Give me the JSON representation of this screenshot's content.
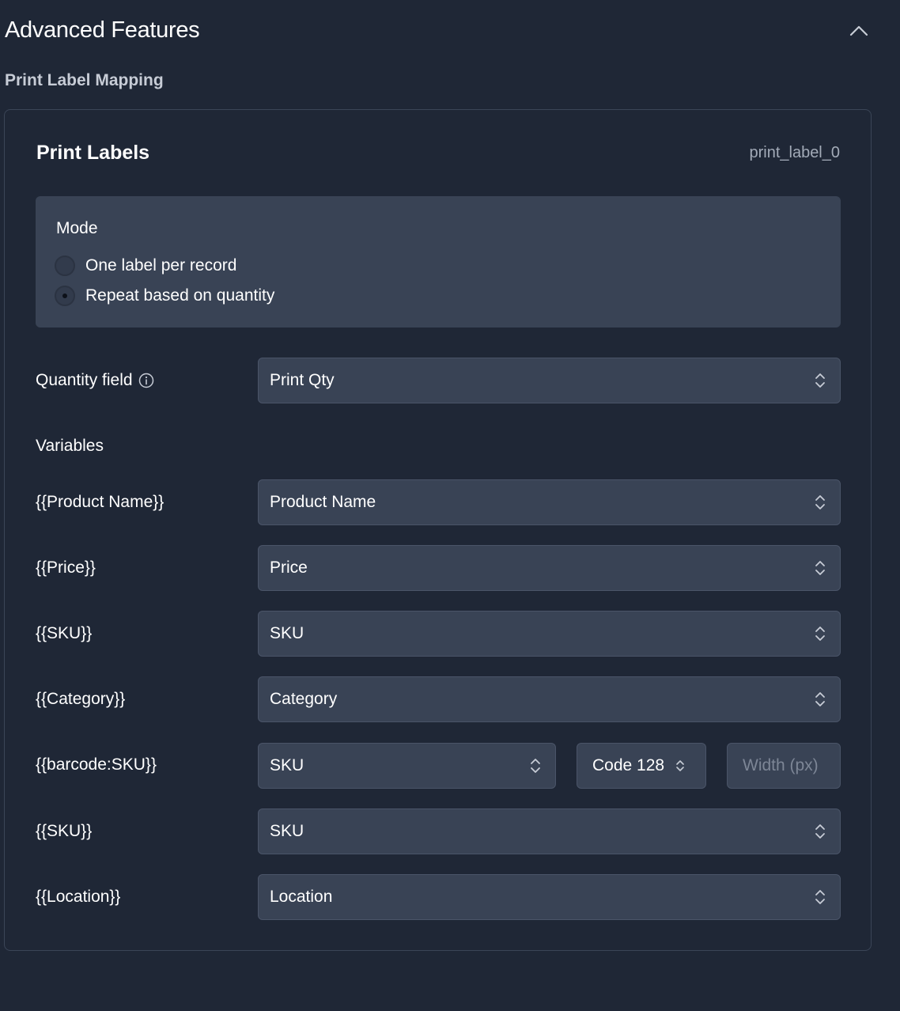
{
  "header": {
    "title": "Advanced Features"
  },
  "section": {
    "label": "Print Label Mapping"
  },
  "card": {
    "title": "Print Labels",
    "id": "print_label_0",
    "mode": {
      "title": "Mode",
      "options": [
        {
          "label": "One label per record",
          "selected": false
        },
        {
          "label": "Repeat based on quantity",
          "selected": true
        }
      ]
    },
    "quantity_field": {
      "label": "Quantity field",
      "value": "Print Qty"
    },
    "variables": {
      "label": "Variables",
      "rows": [
        {
          "label": "{{Product Name}}",
          "value": "Product Name"
        },
        {
          "label": "{{Price}}",
          "value": "Price"
        },
        {
          "label": "{{SKU}}",
          "value": "SKU"
        },
        {
          "label": "{{Category}}",
          "value": "Category"
        },
        {
          "label": "{{barcode:SKU}}",
          "value": "SKU",
          "barcode_type": "Code 128",
          "width_placeholder": "Width (px)"
        },
        {
          "label": "{{SKU}}",
          "value": "SKU"
        },
        {
          "label": "{{Location}}",
          "value": "Location"
        }
      ]
    }
  },
  "colors": {
    "background": "#1f2736",
    "panel": "#394355",
    "border": "#3b4557",
    "text": "#ffffff",
    "muted": "#a3abb8"
  }
}
